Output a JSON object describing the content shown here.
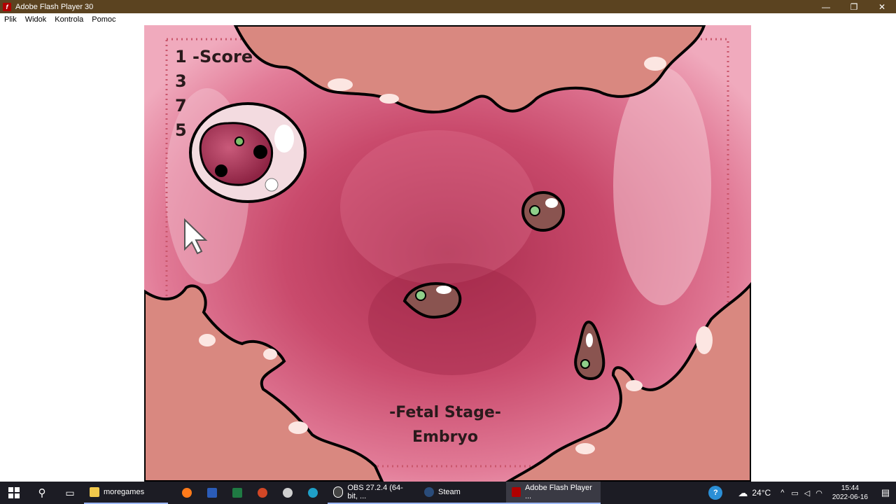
{
  "window": {
    "title": "Adobe Flash Player 30",
    "minimize_glyph": "—",
    "restore_glyph": "❐",
    "close_glyph": "✕"
  },
  "menu": [
    "Plik",
    "Widok",
    "Kontrola",
    "Pomoc"
  ],
  "game": {
    "score_label": "1 -Score",
    "stats": [
      "3",
      "7",
      "5"
    ],
    "stage_title": "-Fetal Stage-",
    "stage_name": "Embryo",
    "colors": {
      "background": "#c9466b",
      "wall": "#d88a84",
      "outline": "#000000"
    }
  },
  "taskbar": {
    "apps": [
      {
        "label": "moregames",
        "icon": "folder-icon",
        "color": "#f2c94c"
      },
      {
        "label": "",
        "icon": "firefox-icon",
        "color": "#ff7a1a"
      },
      {
        "label": "",
        "icon": "word-icon",
        "color": "#2b5cb8"
      },
      {
        "label": "",
        "icon": "excel-icon",
        "color": "#1f7a43"
      },
      {
        "label": "",
        "icon": "powerpoint-icon",
        "color": "#d24726"
      },
      {
        "label": "",
        "icon": "cloud-app-icon",
        "color": "#d0d0d0"
      },
      {
        "label": "",
        "icon": "edge-icon",
        "color": "#1fa0c8"
      },
      {
        "label": "OBS 27.2.4 (64-bit, ...",
        "icon": "obs-icon",
        "color": "#444444"
      },
      {
        "label": "Steam",
        "icon": "steam-icon",
        "color": "#2a4c7a"
      },
      {
        "label": "Adobe Flash Player ...",
        "icon": "flash-icon",
        "color": "#b00000"
      }
    ],
    "weather": "24°C",
    "time": "15:44",
    "date": "2022-06-16"
  }
}
